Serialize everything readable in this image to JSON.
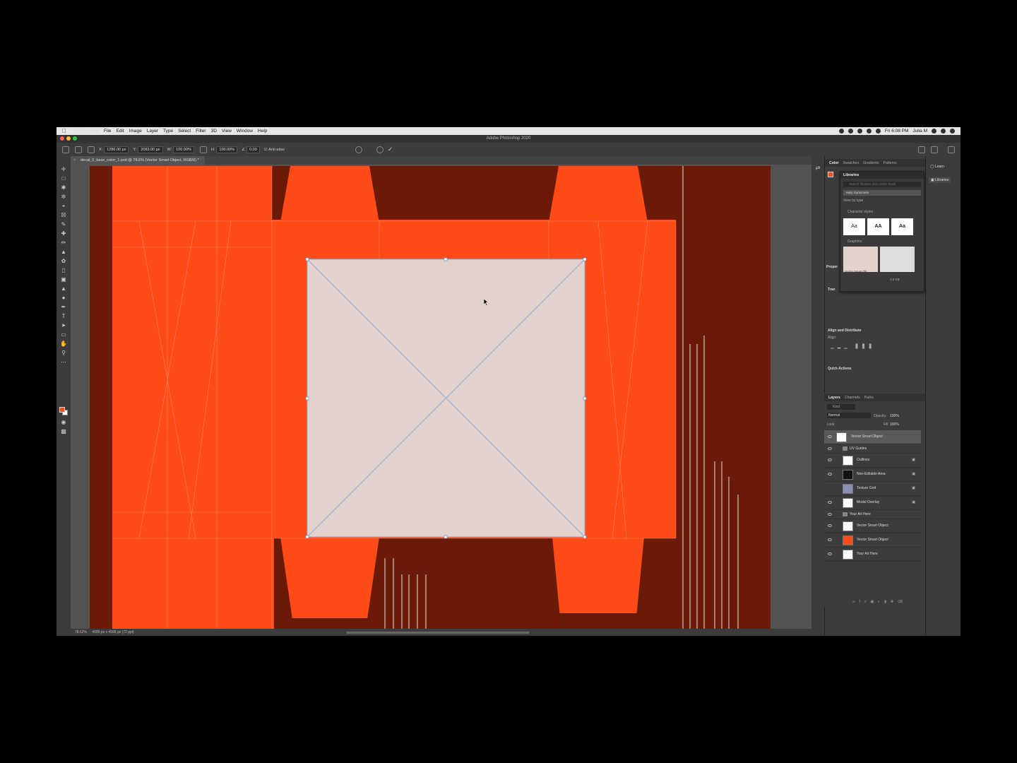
{
  "menubar": {
    "app": "Photoshop",
    "items": [
      "File",
      "Edit",
      "Image",
      "Layer",
      "Type",
      "Select",
      "Filter",
      "3D",
      "View",
      "Window",
      "Help"
    ],
    "clock": "Fri 6:08 PM",
    "user": "Julia M"
  },
  "window": {
    "title": "Adobe Photoshop 2020"
  },
  "options": {
    "x": "1286.00 px",
    "y": "2083.00 px",
    "w": "100.00%",
    "h": "100.00%",
    "angle": "0.00",
    "anti_alias": "Anti-alias"
  },
  "document": {
    "tab": "decal_0_base_color_1.psd @ 78.6% (Vector Smart Object, RGB/8) *",
    "zoom": "78.62%",
    "size": "4096 px x 4096 px (72 ppi)"
  },
  "colors": {
    "accent": "#ff4b17",
    "canvas_bg": "#6b1a08",
    "placed": "#e2d1cd"
  },
  "panels": {
    "color_tabs": [
      "Color",
      "Swatches",
      "Gradients",
      "Patterns"
    ],
    "learn": "Learn",
    "libraries_btn": "Libraries",
    "properties_label": "Proper",
    "transform_label": "Tran",
    "align_label": "Align and Distribute",
    "align_sub": "Align:",
    "quick_actions": "Quick Actions"
  },
  "libraries": {
    "title": "Libraries",
    "search_placeholder": "Search libraries and Adobe Stock",
    "selected_library": "easy Sunscreen",
    "view_by": "View by type",
    "character_styles": "Character styles",
    "cs": [
      "Aa",
      "AA",
      "Aa"
    ],
    "graphics": "Graphics",
    "graphic_caption": "Vector Smart Ob...",
    "size": "3.6 KB"
  },
  "layers": {
    "tabs": [
      "Layers",
      "Channels",
      "Paths"
    ],
    "kind": "Kind",
    "blend": "Normal",
    "opacity_label": "Opacity:",
    "opacity": "100%",
    "lock_label": "Lock:",
    "fill_label": "Fill:",
    "fill": "100%",
    "rows": [
      {
        "name": "Vector Smart Object",
        "type": "layer",
        "selected": true
      },
      {
        "name": "UV Guides",
        "type": "group"
      },
      {
        "name": "Outlines",
        "type": "layer",
        "locked": true
      },
      {
        "name": "Non-Editable Area",
        "type": "layer",
        "locked": true
      },
      {
        "name": "Texture Grid",
        "type": "layer",
        "locked": true
      },
      {
        "name": "Model Overlay",
        "type": "layer",
        "locked": true
      },
      {
        "name": "Your Art Here",
        "type": "group"
      },
      {
        "name": "Vector Smart Object",
        "type": "layer"
      },
      {
        "name": "Vector Smart Object",
        "type": "layer"
      },
      {
        "name": "Your Art Here",
        "type": "layer"
      }
    ]
  }
}
